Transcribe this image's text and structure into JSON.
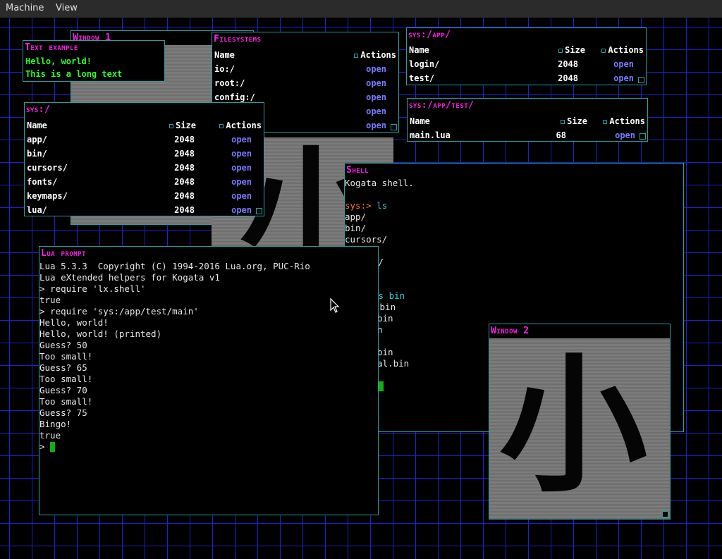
{
  "menubar": {
    "items": [
      "Machine",
      "View"
    ]
  },
  "colors": {
    "title": "#ff1ee6",
    "border": "#2aa0a0",
    "link": "#7a7aff",
    "grid": "#1e23cc"
  },
  "window1": {
    "title": "Window 1"
  },
  "window2": {
    "title": "Window 2",
    "glyph": "小"
  },
  "text_example": {
    "title": "Text example",
    "lines": [
      "Hello, world!",
      "This is a long text"
    ]
  },
  "filesystems": {
    "title": "Filesystems",
    "headers": {
      "name": "Name",
      "actions": "Actions"
    },
    "rows": [
      {
        "name": "io:/",
        "action": "open"
      },
      {
        "name": "root:/",
        "action": "open"
      },
      {
        "name": "config:/",
        "action": "open"
      },
      {
        "name": "",
        "action": "open"
      },
      {
        "name": "",
        "action": "open"
      }
    ]
  },
  "sys_app": {
    "title": "sys:/app/",
    "headers": {
      "name": "Name",
      "size": "Size",
      "actions": "Actions"
    },
    "rows": [
      {
        "name": "login/",
        "size": "2048",
        "action": "open"
      },
      {
        "name": "test/",
        "size": "2048",
        "action": "open"
      }
    ]
  },
  "sys_app_test": {
    "title": "sys:/app/test/",
    "headers": {
      "name": "Name",
      "size": "Size",
      "actions": "Actions"
    },
    "rows": [
      {
        "name": "main.lua",
        "size": "68",
        "action": "open"
      }
    ]
  },
  "sys_root": {
    "title": "sys:/",
    "headers": {
      "name": "Name",
      "size": "Size",
      "actions": "Actions"
    },
    "rows": [
      {
        "name": "app/",
        "size": "2048",
        "action": "open"
      },
      {
        "name": "bin/",
        "size": "2048",
        "action": "open"
      },
      {
        "name": "cursors/",
        "size": "2048",
        "action": "open"
      },
      {
        "name": "fonts/",
        "size": "2048",
        "action": "open"
      },
      {
        "name": "keymaps/",
        "size": "2048",
        "action": "open"
      },
      {
        "name": "lua/",
        "size": "2048",
        "action": "open"
      }
    ]
  },
  "shell": {
    "title": "Shell",
    "banner": "Kogata shell.",
    "prompt": "sys:>",
    "cmd1": " ls",
    "ls_output": [
      "app/",
      "bin/",
      "cursors/",
      "",
      "s/"
    ],
    "cmd2_tail": "ls bin",
    "bin_output": [
      ".bin",
      "bin",
      "n",
      "",
      "bin",
      "al.bin"
    ]
  },
  "lua_prompt": {
    "title": "Lua prompt",
    "lines": [
      "Lua 5.3.3  Copyright (C) 1994-2016 Lua.org, PUC-Rio",
      "Lua eXtended helpers for Kogata v1",
      "> require 'lx.shell'",
      "true",
      "> require 'sys:/app/test/main'",
      "Hello, world!",
      "Hello, world! (printed)",
      "Guess? 50",
      "Too small!",
      "Guess? 65",
      "Too small!",
      "Guess? 70",
      "Too small!",
      "Guess? 75",
      "Bingo!",
      "true"
    ],
    "input_prompt": "> "
  }
}
